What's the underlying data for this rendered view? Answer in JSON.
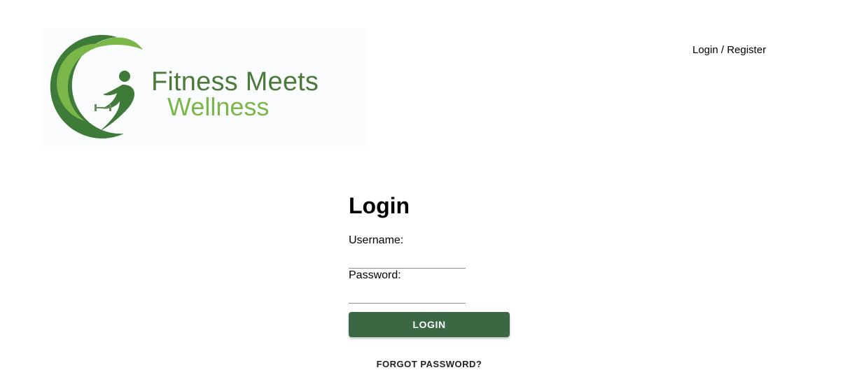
{
  "header": {
    "logo": {
      "line1": "Fitness Meets",
      "line2": "Wellness",
      "colors": {
        "dark_green": "#4b7a3a",
        "light_green": "#7ab648"
      }
    },
    "auth_link": "Login / Register"
  },
  "login_form": {
    "title": "Login",
    "username_label": "Username:",
    "username_value": "",
    "password_label": "Password:",
    "password_value": "",
    "submit_label": "LOGIN",
    "forgot_label": "FORGOT PASSWORD?",
    "colors": {
      "button": "#3a6842",
      "button_text": "#ffffff"
    }
  }
}
